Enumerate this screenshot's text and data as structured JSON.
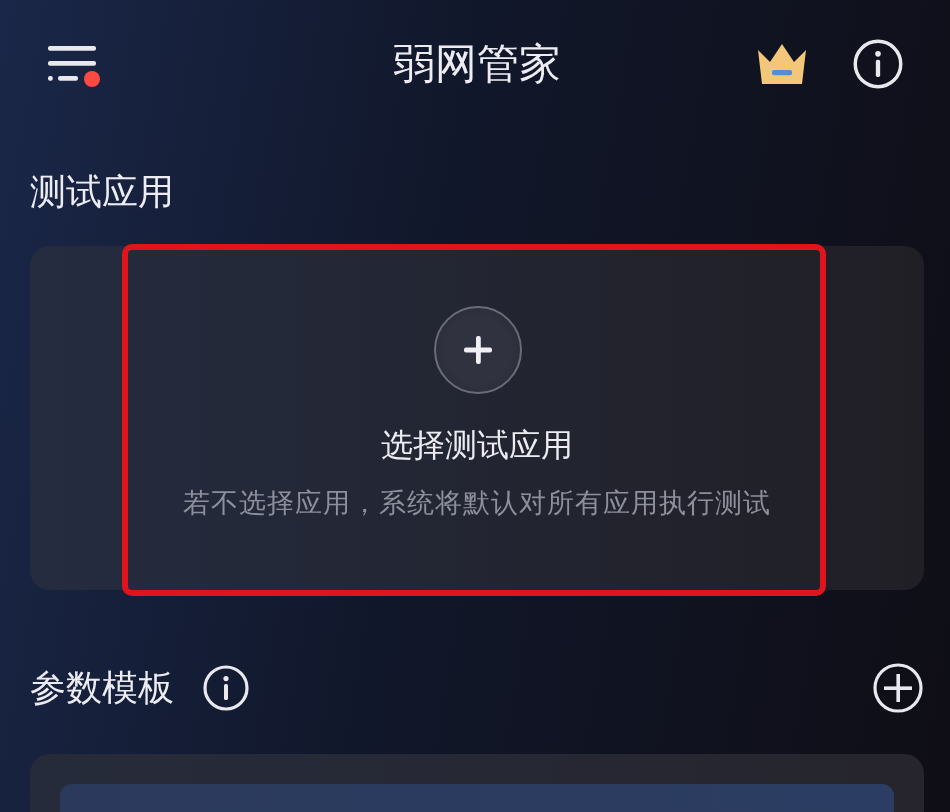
{
  "header": {
    "title": "弱网管家",
    "menu_badge": true
  },
  "test_app": {
    "title": "测试应用",
    "prompt": "选择测试应用",
    "hint": "若不选择应用，系统将默认对所有应用执行测试",
    "highlighted": true
  },
  "templates": {
    "title": "参数模板"
  }
}
